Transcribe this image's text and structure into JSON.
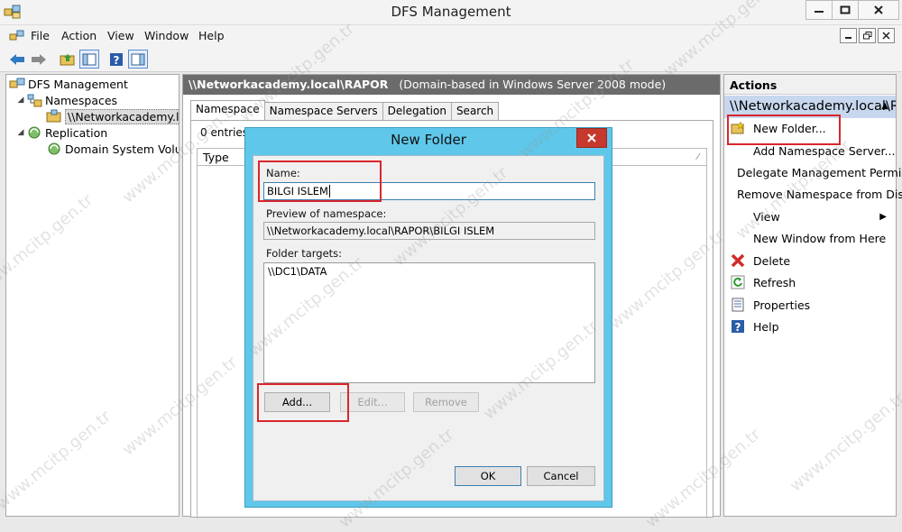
{
  "window": {
    "title": "DFS Management"
  },
  "menu": [
    "File",
    "Action",
    "View",
    "Window",
    "Help"
  ],
  "tree": {
    "root": "DFS Management",
    "namespaces": "Namespaces",
    "namespace_item": "\\\\Networkacademy.local\\RAPOR",
    "replication": "Replication",
    "replication_item": "Domain System Volume"
  },
  "center": {
    "header_path": "\\\\Networkacademy.local\\RAPOR",
    "header_mode": "(Domain-based in Windows Server 2008 mode)",
    "tabs": [
      "Namespace",
      "Namespace Servers",
      "Delegation",
      "Search"
    ],
    "entries": "0 entries",
    "column_type": "Type"
  },
  "actions": {
    "title": "Actions",
    "section": "\\\\Networkacademy.local\\RAPOR",
    "items": [
      {
        "label": "New Folder...",
        "icon": "new-folder-icon"
      },
      {
        "label": "Add Namespace Server...",
        "icon": ""
      },
      {
        "label": "Delegate Management Permissions...",
        "icon": ""
      },
      {
        "label": "Remove Namespace from Display",
        "icon": ""
      },
      {
        "label": "View",
        "icon": ""
      },
      {
        "label": "New Window from Here",
        "icon": ""
      },
      {
        "label": "Delete",
        "icon": "delete-icon"
      },
      {
        "label": "Refresh",
        "icon": "refresh-icon"
      },
      {
        "label": "Properties",
        "icon": "properties-icon"
      },
      {
        "label": "Help",
        "icon": "help-icon"
      }
    ]
  },
  "dialog": {
    "title": "New Folder",
    "name_label": "Name:",
    "name_value": "BILGI ISLEM",
    "preview_label": "Preview of namespace:",
    "preview_value": "\\\\Networkacademy.local\\RAPOR\\BILGI ISLEM",
    "targets_label": "Folder targets:",
    "targets": [
      "\\\\DC1\\DATA"
    ],
    "add_label": "Add...",
    "edit_label": "Edit...",
    "remove_label": "Remove",
    "ok_label": "OK",
    "cancel_label": "Cancel"
  },
  "watermark": "www.mcitp.gen.tr",
  "colors": {
    "dialog_frame": "#5fc7ea",
    "close_button": "#c7392d",
    "annotation": "#d9262c",
    "header_bar": "#6b6b6b",
    "actions_section": "#c7d7ee"
  }
}
